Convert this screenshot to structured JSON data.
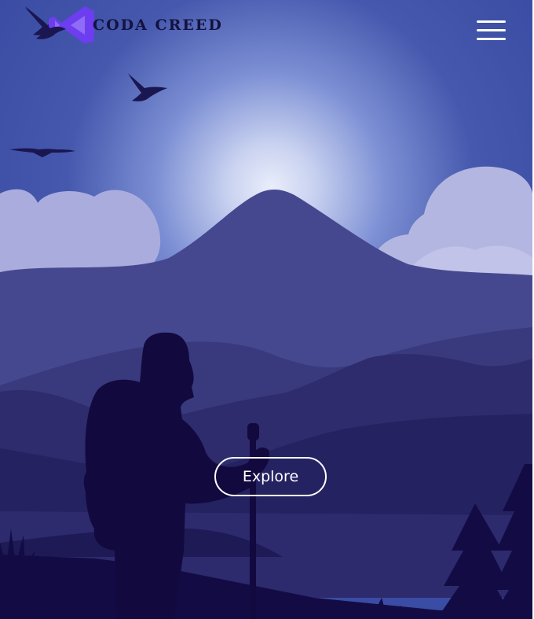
{
  "brand": {
    "name": "CODA CREED",
    "logo_icon": "vs-code-logo-icon"
  },
  "nav": {
    "menu_icon": "hamburger-menu-icon"
  },
  "hero": {
    "cta_label": "Explore"
  },
  "colors": {
    "sky_top": "#3d4fa5",
    "sun_glow": "#dce4f6",
    "mountain": "#46488f",
    "silhouette": "#12093f",
    "logo_accent": "#6d3df0",
    "button_border": "#ffffff"
  }
}
